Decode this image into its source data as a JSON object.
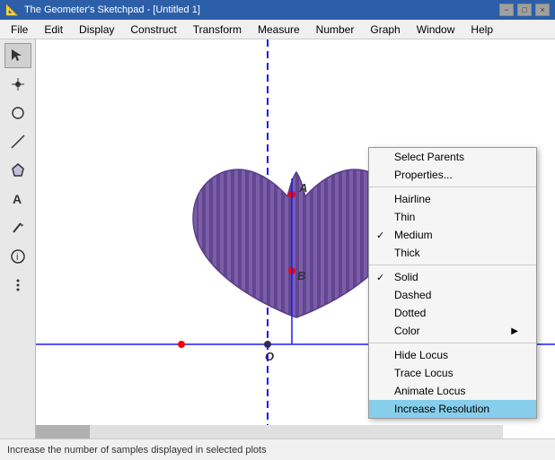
{
  "titleBar": {
    "appName": "The Geometer's Sketchpad",
    "docName": "[Untitled 1]",
    "minBtn": "−",
    "maxBtn": "□",
    "closeBtn": "×"
  },
  "menuBar": {
    "items": [
      "File",
      "Edit",
      "Display",
      "Construct",
      "Transform",
      "Measure",
      "Number",
      "Graph",
      "Window",
      "Help"
    ]
  },
  "toolbar": {
    "tools": [
      {
        "name": "select",
        "symbol": "↖"
      },
      {
        "name": "point",
        "symbol": "•"
      },
      {
        "name": "circle",
        "symbol": "○"
      },
      {
        "name": "line",
        "symbol": "/"
      },
      {
        "name": "polygon",
        "symbol": "⬠"
      },
      {
        "name": "text",
        "symbol": "A"
      },
      {
        "name": "marker",
        "symbol": "✏"
      },
      {
        "name": "info",
        "symbol": "ℹ"
      },
      {
        "name": "custom",
        "symbol": "⋮"
      }
    ]
  },
  "contextMenu": {
    "items": [
      {
        "label": "Select Parents",
        "check": "",
        "hasArrow": false,
        "highlighted": false,
        "disabled": false
      },
      {
        "label": "Properties...",
        "check": "",
        "hasArrow": false,
        "highlighted": false,
        "disabled": false
      },
      {
        "separator": true
      },
      {
        "label": "Hairline",
        "check": "",
        "hasArrow": false,
        "highlighted": false,
        "disabled": false
      },
      {
        "label": "Thin",
        "check": "",
        "hasArrow": false,
        "highlighted": false,
        "disabled": false
      },
      {
        "label": "Medium",
        "check": "✓",
        "hasArrow": false,
        "highlighted": false,
        "disabled": false
      },
      {
        "label": "Thick",
        "check": "",
        "hasArrow": false,
        "highlighted": false,
        "disabled": false
      },
      {
        "separator": true
      },
      {
        "label": "Solid",
        "check": "✓",
        "hasArrow": false,
        "highlighted": false,
        "disabled": false
      },
      {
        "label": "Dashed",
        "check": "",
        "hasArrow": false,
        "highlighted": false,
        "disabled": false
      },
      {
        "label": "Dotted",
        "check": "",
        "hasArrow": false,
        "highlighted": false,
        "disabled": false
      },
      {
        "label": "Color",
        "check": "",
        "hasArrow": true,
        "highlighted": false,
        "disabled": false
      },
      {
        "separator": true
      },
      {
        "label": "Hide Locus",
        "check": "",
        "hasArrow": false,
        "highlighted": false,
        "disabled": false
      },
      {
        "label": "Trace Locus",
        "check": "",
        "hasArrow": false,
        "highlighted": false,
        "disabled": false
      },
      {
        "label": "Animate Locus",
        "check": "",
        "hasArrow": false,
        "highlighted": false,
        "disabled": false
      },
      {
        "label": "Increase Resolution",
        "check": "",
        "hasArrow": false,
        "highlighted": true,
        "disabled": false
      }
    ]
  },
  "statusBar": {
    "text": "Increase the number of samples displayed in selected plots"
  }
}
